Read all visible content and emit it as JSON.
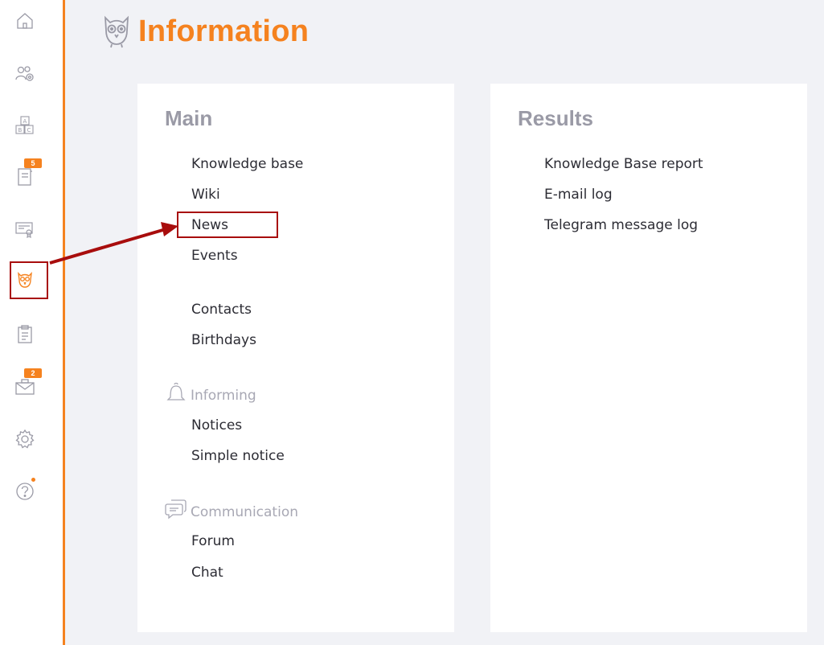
{
  "header": {
    "title": "Information",
    "icon": "owl-icon"
  },
  "sidebar": {
    "accent_color": "#f5821f",
    "items": [
      {
        "icon": "home-icon",
        "badge": ""
      },
      {
        "icon": "users-settings-icon",
        "badge": ""
      },
      {
        "icon": "abc-blocks-icon",
        "badge": ""
      },
      {
        "icon": "notebook-icon",
        "badge": "5"
      },
      {
        "icon": "certificate-icon",
        "badge": ""
      },
      {
        "icon": "owl-icon",
        "badge": "",
        "active": true
      },
      {
        "icon": "clipboard-icon",
        "badge": ""
      },
      {
        "icon": "mail-case-icon",
        "badge": "2"
      },
      {
        "icon": "gear-icon",
        "badge": ""
      },
      {
        "icon": "help-icon",
        "badge": "",
        "dot": true
      }
    ]
  },
  "main_panel": {
    "heading": "Main",
    "links": {
      "knowledge_base": "Knowledge base",
      "wiki": "Wiki",
      "news": "News",
      "events": "Events",
      "contacts": "Contacts",
      "birthdays": "Birthdays"
    },
    "informing": {
      "label": "Informing",
      "icon": "bell-icon",
      "notices": "Notices",
      "simple_notice": "Simple notice"
    },
    "communication": {
      "label": "Communication",
      "icon": "chat-bubbles-icon",
      "forum": "Forum",
      "chat": "Chat"
    }
  },
  "results_panel": {
    "heading": "Results",
    "links": {
      "kb_report": "Knowledge Base report",
      "email_log": "E-mail log",
      "telegram_log": "Telegram message log"
    }
  },
  "annotation": {
    "color": "#a80d0d"
  }
}
